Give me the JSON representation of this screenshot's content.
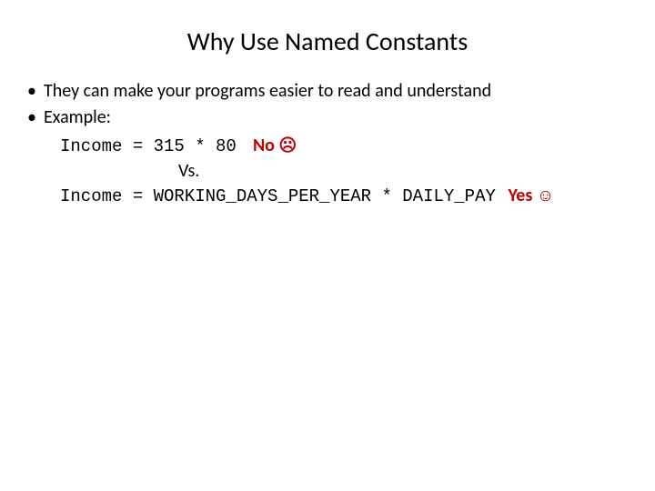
{
  "title": "Why Use Named Constants",
  "bullets": {
    "b1": "They can make your programs easier to read and understand",
    "b2": "Example:"
  },
  "example": {
    "line1_code": "Income = 315 * 80",
    "no_label": "No",
    "no_emo": "☹",
    "vs": "Vs.",
    "line2_code": "Income = WORKING_DAYS_PER_YEAR * DAILY_PAY",
    "yes_label": "Yes",
    "yes_emo": "☺"
  }
}
